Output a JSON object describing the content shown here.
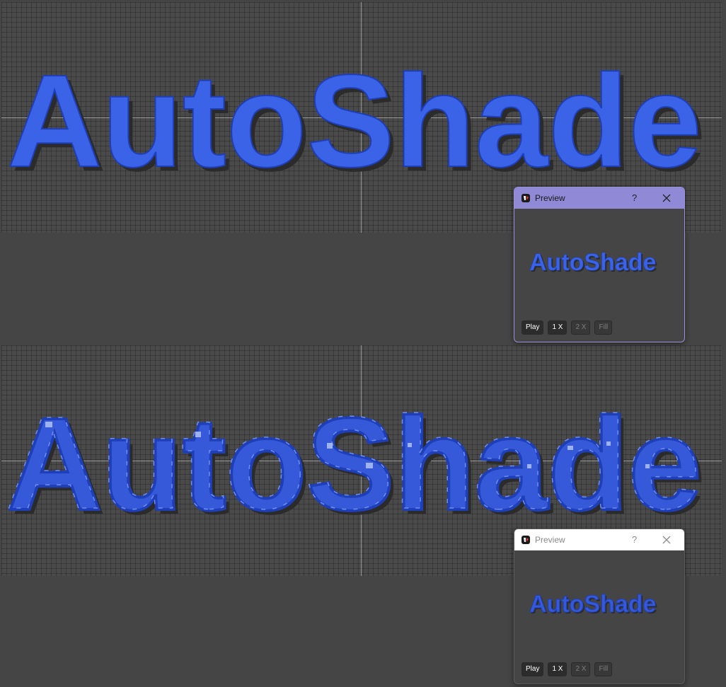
{
  "canvas_top": {
    "art_text": "AutoShade"
  },
  "canvas_bottom": {
    "art_text": "AutoShade"
  },
  "preview_top": {
    "title": "Preview",
    "help": "?",
    "logo_text": "AutoShade",
    "buttons": {
      "play": "Play",
      "one_x": "1 X",
      "two_x": "2 X",
      "fill": "Fill"
    }
  },
  "preview_bottom": {
    "title": "Preview",
    "help": "?",
    "logo_text": "AutoShade",
    "buttons": {
      "play": "Play",
      "one_x": "1 X",
      "two_x": "2 X",
      "fill": "Fill"
    }
  },
  "colors": {
    "text_blue": "#3a63e8",
    "text_edge": "#1f3fb8",
    "shadow": "#2b2b2b",
    "highlight": "#9fb2f0",
    "title_active": "#8f89d6",
    "title_inactive": "#ffffff"
  }
}
